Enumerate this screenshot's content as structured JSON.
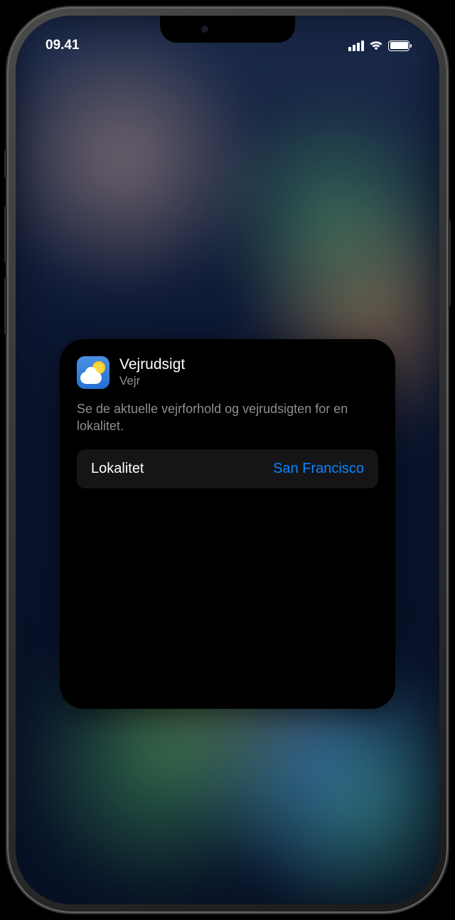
{
  "status_bar": {
    "time": "09.41"
  },
  "widget": {
    "title": "Vejrudsigt",
    "app_name": "Vejr",
    "description": "Se de aktuelle vejrforhold og vejrudsigten for en lokalitet.",
    "setting": {
      "label": "Lokalitet",
      "value": "San Francisco"
    }
  }
}
